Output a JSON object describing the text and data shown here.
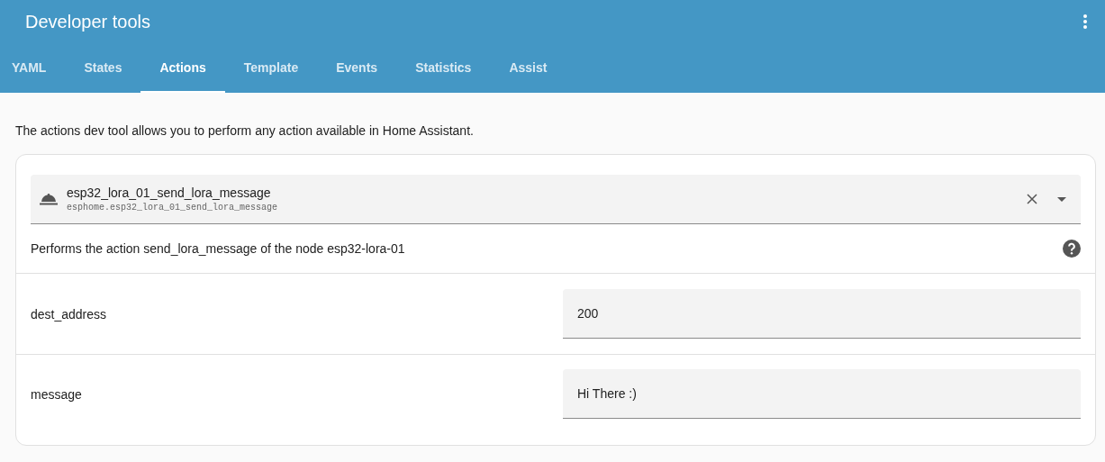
{
  "window": {
    "title": "Developer tools"
  },
  "tabs": [
    {
      "label": "YAML",
      "selected": false
    },
    {
      "label": "States",
      "selected": false
    },
    {
      "label": "Actions",
      "selected": true
    },
    {
      "label": "Template",
      "selected": false
    },
    {
      "label": "Events",
      "selected": false
    },
    {
      "label": "Statistics",
      "selected": false
    },
    {
      "label": "Assist",
      "selected": false
    }
  ],
  "intro": "The actions dev tool allows you to perform any action available in Home Assistant.",
  "action_picker": {
    "name": "esp32_lora_01_send_lora_message",
    "id": "esphome.esp32_lora_01_send_lora_message"
  },
  "action_description": "Performs the action send_lora_message of the node esp32-lora-01",
  "fields": [
    {
      "label": "dest_address",
      "value": "200"
    },
    {
      "label": "message",
      "value": "Hi There :)"
    }
  ]
}
